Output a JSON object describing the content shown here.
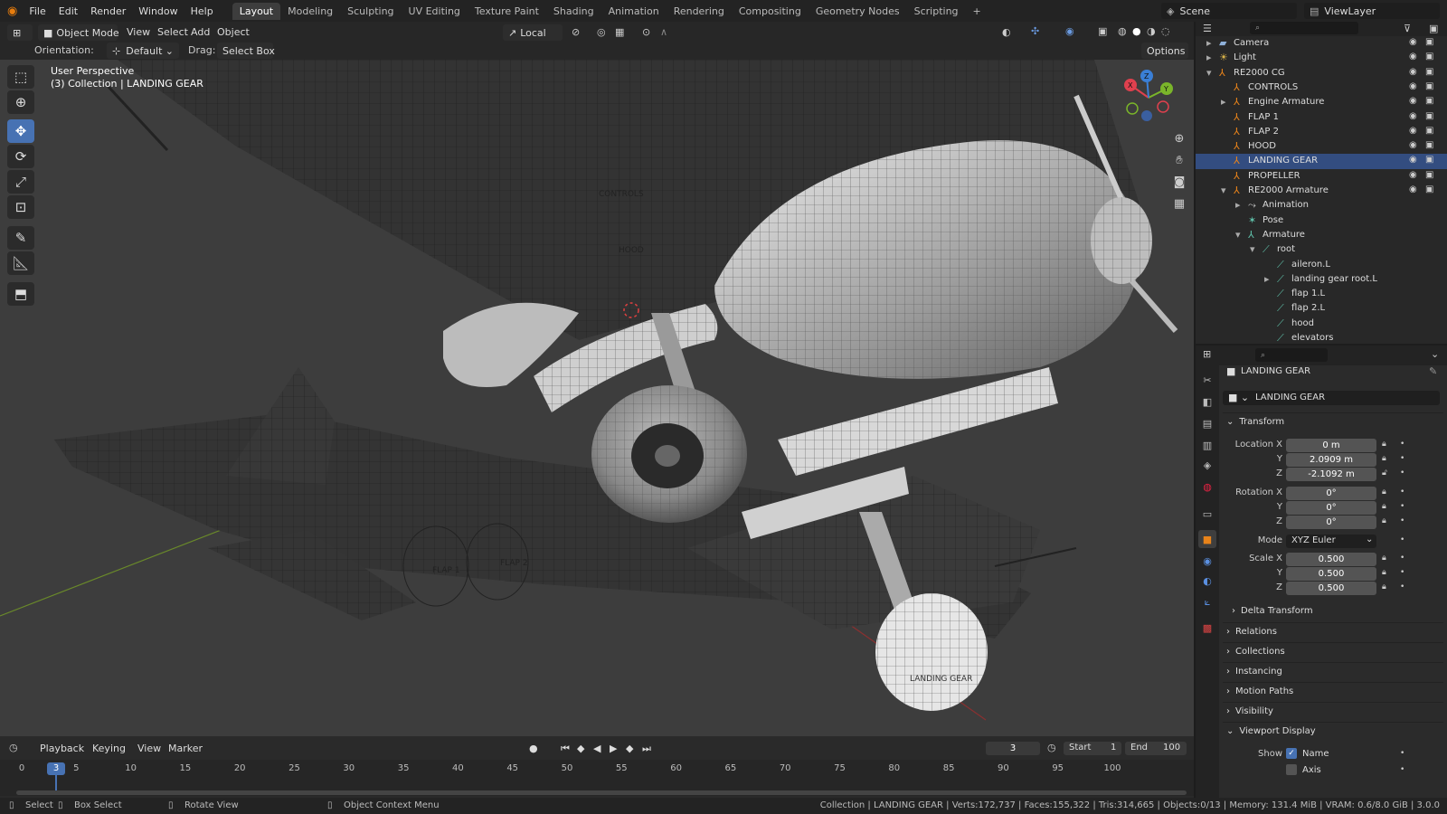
{
  "menubar": {
    "items": [
      "File",
      "Edit",
      "Render",
      "Window",
      "Help"
    ],
    "workspaces": [
      "Layout",
      "Modeling",
      "Sculpting",
      "UV Editing",
      "Texture Paint",
      "Shading",
      "Animation",
      "Rendering",
      "Compositing",
      "Geometry Nodes",
      "Scripting"
    ],
    "active_workspace": "Layout",
    "add_tab": "+",
    "scene": "Scene",
    "view_layer": "ViewLayer"
  },
  "viewport_header": {
    "mode": "Object Mode",
    "menus": [
      "View",
      "Select",
      "Add",
      "Object"
    ],
    "transform_space": "Local",
    "orientation_label": "Orientation:",
    "orientation_value": "Default",
    "drag_label": "Drag:",
    "drag_value": "Select Box",
    "options": "Options"
  },
  "viewport": {
    "perspective": "User Perspective",
    "collection_info": "(3) Collection | LANDING GEAR",
    "overlay_labels": [
      "CONTROLS",
      "HOOD",
      "FLAP 1",
      "FLAP 2",
      "LANDING GEAR"
    ],
    "gizmo_axes": [
      "X",
      "Y",
      "Z"
    ]
  },
  "outliner": {
    "rows": [
      {
        "name": "Camera",
        "icon": "camera-icon",
        "indent": 0,
        "expand": "▸"
      },
      {
        "name": "Light",
        "icon": "light-icon",
        "indent": 0,
        "expand": "▸"
      },
      {
        "name": "RE2000 CG",
        "icon": "empty-icon",
        "indent": 0,
        "expand": "▾"
      },
      {
        "name": "CONTROLS",
        "icon": "empty-icon",
        "indent": 1,
        "expand": ""
      },
      {
        "name": "Engine Armature",
        "icon": "armature-icon",
        "indent": 1,
        "expand": "▸"
      },
      {
        "name": "FLAP 1",
        "icon": "empty-icon",
        "indent": 1,
        "expand": ""
      },
      {
        "name": "FLAP 2",
        "icon": "empty-icon",
        "indent": 1,
        "expand": ""
      },
      {
        "name": "HOOD",
        "icon": "empty-icon",
        "indent": 1,
        "expand": ""
      },
      {
        "name": "LANDING GEAR",
        "icon": "empty-icon",
        "indent": 1,
        "expand": "",
        "selected": true
      },
      {
        "name": "PROPELLER",
        "icon": "empty-icon",
        "indent": 1,
        "expand": ""
      },
      {
        "name": "RE2000 Armature",
        "icon": "armature-icon",
        "indent": 1,
        "expand": "▾"
      },
      {
        "name": "Animation",
        "icon": "animation-icon",
        "indent": 2,
        "expand": "▸"
      },
      {
        "name": "Pose",
        "icon": "pose-icon",
        "indent": 2,
        "expand": ""
      },
      {
        "name": "Armature",
        "icon": "armature-data-icon",
        "indent": 2,
        "expand": "▾"
      },
      {
        "name": "root",
        "icon": "bone-icon",
        "indent": 3,
        "expand": "▾"
      },
      {
        "name": "aileron.L",
        "icon": "bone-icon",
        "indent": 4,
        "expand": ""
      },
      {
        "name": "landing gear root.L",
        "icon": "bone-icon",
        "indent": 4,
        "expand": "▸"
      },
      {
        "name": "flap 1.L",
        "icon": "bone-icon",
        "indent": 4,
        "expand": ""
      },
      {
        "name": "flap 2.L",
        "icon": "bone-icon",
        "indent": 4,
        "expand": ""
      },
      {
        "name": "hood",
        "icon": "bone-icon",
        "indent": 4,
        "expand": ""
      },
      {
        "name": "elevators",
        "icon": "bone-icon",
        "indent": 4,
        "expand": ""
      }
    ]
  },
  "properties": {
    "object_name": "LANDING GEAR",
    "datablock_name": "LANDING GEAR",
    "transform_header": "Transform",
    "location": {
      "label_x": "Location X",
      "label_y": "Y",
      "label_z": "Z",
      "x": "0 m",
      "y": "2.0909 m",
      "z": "-2.1092 m"
    },
    "rotation": {
      "label_x": "Rotation X",
      "label_y": "Y",
      "label_z": "Z",
      "x": "0°",
      "y": "0°",
      "z": "0°"
    },
    "mode_label": "Mode",
    "mode_value": "XYZ Euler",
    "scale": {
      "label_x": "Scale X",
      "label_y": "Y",
      "label_z": "Z",
      "x": "0.500",
      "y": "0.500",
      "z": "0.500"
    },
    "delta_transform": "Delta Transform",
    "panels": [
      "Relations",
      "Collections",
      "Instancing",
      "Motion Paths",
      "Visibility"
    ],
    "viewport_display": "Viewport Display",
    "show_label": "Show",
    "show_name": "Name",
    "show_axis": "Axis",
    "show_name_checked": true,
    "show_axis_checked": false
  },
  "timeline": {
    "menus": [
      "Playback",
      "Keying",
      "View",
      "Marker"
    ],
    "current_frame": "3",
    "start_label": "Start",
    "start": "1",
    "end_label": "End",
    "end": "100",
    "ticks": [
      "0",
      "5",
      "10",
      "15",
      "20",
      "25",
      "30",
      "35",
      "40",
      "45",
      "50",
      "55",
      "60",
      "65",
      "70",
      "75",
      "80",
      "85",
      "90",
      "95",
      "100"
    ],
    "playhead": "3"
  },
  "statusbar": {
    "select": "Select",
    "box_select": "Box Select",
    "rotate_view": "Rotate View",
    "context_menu": "Object Context Menu",
    "stats": "Collection | LANDING GEAR | Verts:172,737 | Faces:155,322 | Tris:314,665 | Objects:0/13 | Memory: 131.4 MiB | VRAM: 0.6/8.0 GiB | 3.0.0"
  },
  "colors": {
    "accent": "#4772b3",
    "selected_row": "#334d80",
    "viewport_bg": "#3d3d3d",
    "panel_bg": "#2b2b2b"
  }
}
